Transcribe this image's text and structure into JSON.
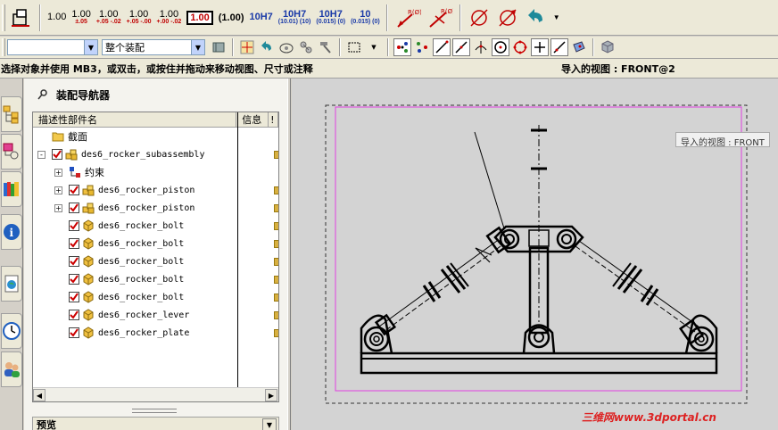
{
  "toolbar1": {
    "dims": [
      {
        "main": "1.00",
        "tol": ""
      },
      {
        "main": "1.00",
        "tol": "±.05"
      },
      {
        "main": "1.00",
        "tol": "+.05 -.02"
      },
      {
        "main": "1.00",
        "tol": "+.05 -.00"
      },
      {
        "main": "1.00",
        "tol": "+.00 -.02"
      }
    ],
    "boxed_dim": "1.00",
    "paren_dim": "(1.00)",
    "fit_dims": [
      {
        "main": "10H7",
        "tol": ""
      },
      {
        "main": "10H7",
        "tol": "(10.01) (10)"
      },
      {
        "main": "10H7",
        "tol": "(0.015) (0)"
      },
      {
        "main": "10",
        "tol": "(0.015) (0)"
      }
    ],
    "radius_labels": [
      "R(Ø)",
      "R(Ø)"
    ]
  },
  "toolbar2": {
    "filter_combo": "",
    "scope_combo": "整个装配"
  },
  "status": {
    "message": "选择对象并使用 MB3，或双击，或按住并拖动来移动视图、尺寸或注释",
    "view_info": "导入的视图 : FRONT@2"
  },
  "navigator": {
    "title": "装配导航器",
    "columns": [
      "描述性部件名",
      "信息",
      "!"
    ],
    "rows": [
      {
        "label": "截面",
        "level": 0,
        "type": "folder",
        "expand": "",
        "checked": false,
        "lock": false
      },
      {
        "label": "des6_rocker_subassembly",
        "level": 0,
        "type": "assembly",
        "expand": "-",
        "checked": true,
        "lock": true
      },
      {
        "label": "约束",
        "level": 1,
        "type": "constraint",
        "expand": "+",
        "checked": false,
        "lock": false
      },
      {
        "label": "des6_rocker_piston",
        "level": 1,
        "type": "assembly",
        "expand": "+",
        "checked": true,
        "lock": true
      },
      {
        "label": "des6_rocker_piston",
        "level": 1,
        "type": "assembly",
        "expand": "+",
        "checked": true,
        "lock": true
      },
      {
        "label": "des6_rocker_bolt",
        "level": 1,
        "type": "part",
        "expand": "",
        "checked": true,
        "lock": true
      },
      {
        "label": "des6_rocker_bolt",
        "level": 1,
        "type": "part",
        "expand": "",
        "checked": true,
        "lock": true
      },
      {
        "label": "des6_rocker_bolt",
        "level": 1,
        "type": "part",
        "expand": "",
        "checked": true,
        "lock": true
      },
      {
        "label": "des6_rocker_bolt",
        "level": 1,
        "type": "part",
        "expand": "",
        "checked": true,
        "lock": true
      },
      {
        "label": "des6_rocker_bolt",
        "level": 1,
        "type": "part",
        "expand": "",
        "checked": true,
        "lock": true
      },
      {
        "label": "des6_rocker_lever",
        "level": 1,
        "type": "part",
        "expand": "",
        "checked": true,
        "lock": true
      },
      {
        "label": "des6_rocker_plate",
        "level": 1,
        "type": "part",
        "expand": "",
        "checked": true,
        "lock": true
      }
    ],
    "preview_label": "预览"
  },
  "graphics": {
    "tooltip": "导入的视图 : FRONT",
    "watermark": "三维网www.3dportal.cn"
  },
  "colors": {
    "accent_red": "#c00000",
    "accent_blue": "#1a3aa8",
    "sheet_border": "#e040e0",
    "check_red": "#cc0000"
  }
}
